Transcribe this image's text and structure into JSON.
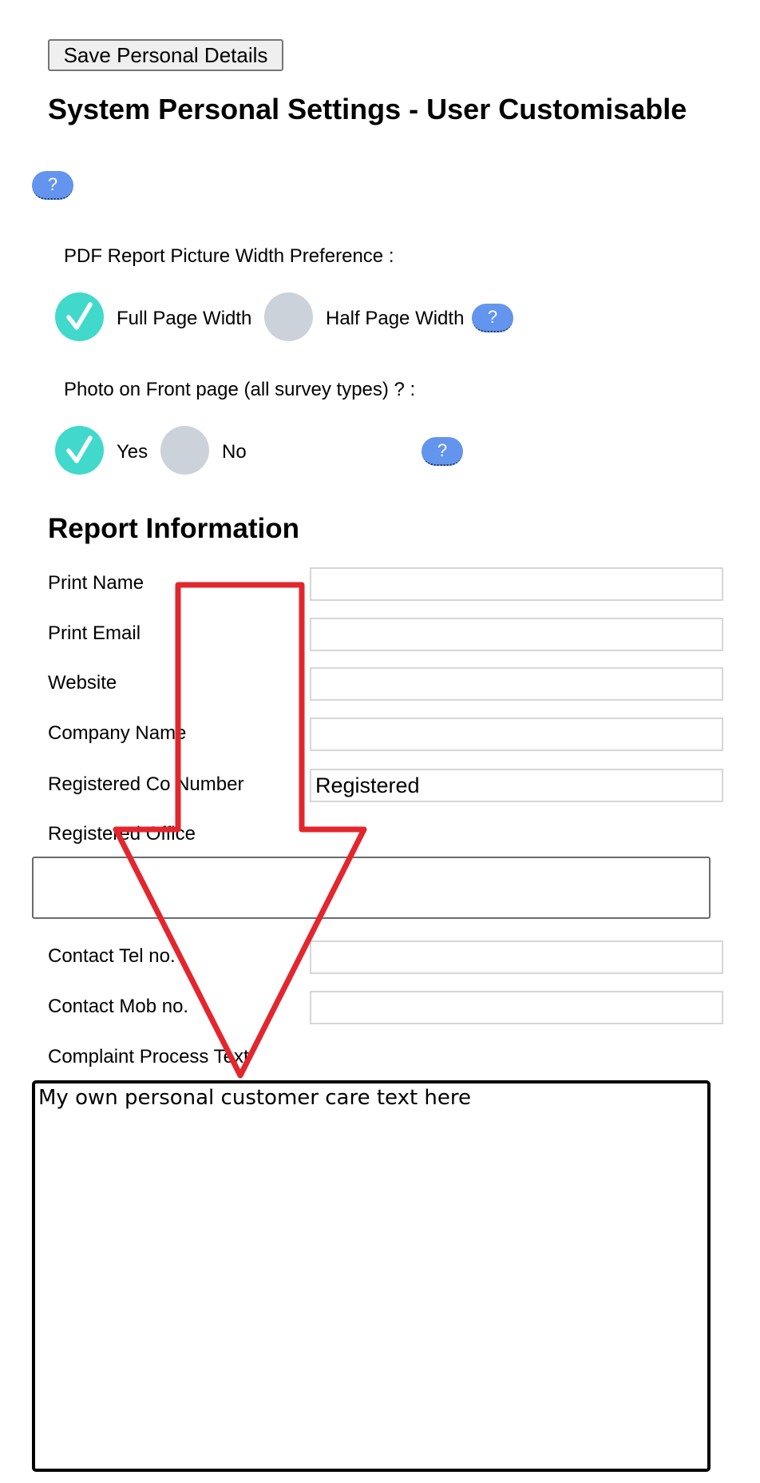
{
  "toolbar": {
    "save_label": "Save Personal Details"
  },
  "page": {
    "title": "System Personal Settings - User Customisable"
  },
  "help_label": "?",
  "pdf_width": {
    "question": "PDF Report Picture Width Preference :",
    "options": [
      {
        "label": "Full Page Width",
        "selected": true
      },
      {
        "label": "Half Page Width",
        "selected": false
      }
    ]
  },
  "front_photo": {
    "question": "Photo on Front page (all survey types) ? :",
    "options": [
      {
        "label": "Yes",
        "selected": true
      },
      {
        "label": "No",
        "selected": false
      }
    ]
  },
  "report": {
    "heading": "Report Information",
    "fields": {
      "print_name": {
        "label": "Print Name",
        "value": ""
      },
      "print_email": {
        "label": "Print Email",
        "value": ""
      },
      "website": {
        "label": "Website",
        "value": ""
      },
      "company_name": {
        "label": "Company Name",
        "value": ""
      },
      "reg_number": {
        "label": "Registered Co Number",
        "value": "Registered"
      },
      "reg_office": {
        "label": "Registered Office",
        "value": ""
      },
      "tel": {
        "label": "Contact Tel no.",
        "value": ""
      },
      "mob": {
        "label": "Contact Mob no.",
        "value": ""
      },
      "complaint": {
        "label": "Complaint Process Text",
        "value": "My own personal customer care text here"
      }
    }
  },
  "colors": {
    "accent_help": "#6395ee",
    "radio_checked": "#40d9cc",
    "radio_unchecked": "#ccd2da",
    "annotation_arrow": "#e3262e"
  }
}
